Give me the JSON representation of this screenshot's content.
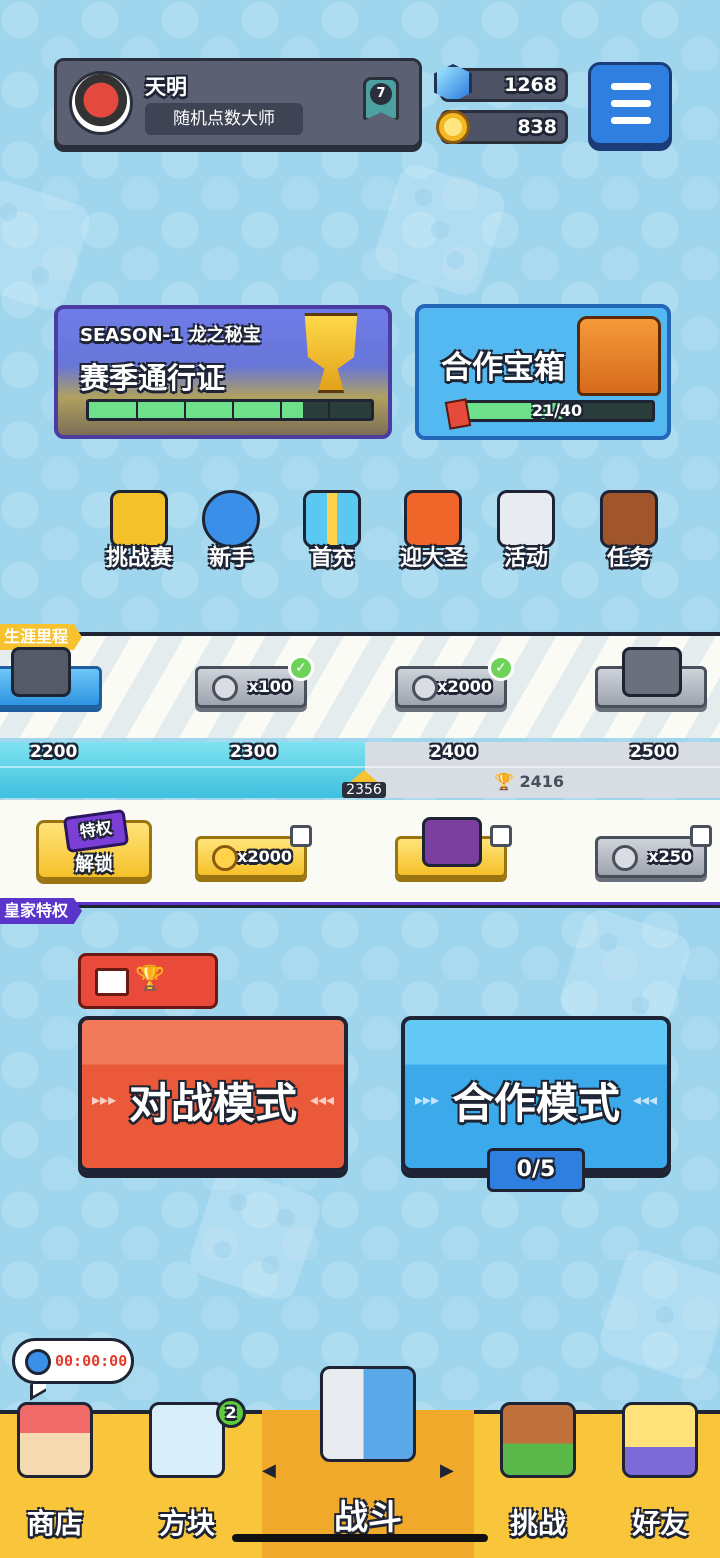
{
  "profile": {
    "name": "天明",
    "title": "随机点数大师",
    "rank": "7"
  },
  "currency": {
    "gems": "1268",
    "coins": "838"
  },
  "season_pass": {
    "subtitle": "SEASON-1 龙之秘宝",
    "title": "赛季通行证",
    "progress": 0.76
  },
  "coop_chest": {
    "title": "合作宝箱",
    "progress_label": "21/40",
    "progress": 0.525
  },
  "features": [
    {
      "label": "挑战赛",
      "icon": "challenge-box-icon",
      "color": "#f5c12a"
    },
    {
      "label": "新手",
      "icon": "stopwatch-icon",
      "color": "#3a8fe8"
    },
    {
      "label": "首充",
      "icon": "gift-box-icon",
      "color": "#ffd24a"
    },
    {
      "label": "迎大圣",
      "icon": "lantern-icon",
      "color": "#f0662a"
    },
    {
      "label": "活动",
      "icon": "document-icon",
      "color": "#e8ecf0"
    },
    {
      "label": "任务",
      "icon": "quest-book-icon",
      "color": "#a0552a"
    }
  ],
  "career": {
    "tag": "生涯里程",
    "top_rewards": [
      {
        "label": "",
        "icon": "skull-chest-icon",
        "claimed": false
      },
      {
        "label": "x100",
        "icon": "dice-icon",
        "claimed": true
      },
      {
        "label": "x2000",
        "icon": "silver-coin-icon",
        "claimed": true
      },
      {
        "label": "",
        "icon": "silver-chest-icon",
        "claimed": false
      }
    ],
    "milestones": [
      "2200",
      "2300",
      "2400",
      "2500"
    ],
    "current": "2356",
    "next_trophy": "2416",
    "bottom_rewards": [
      {
        "label": "x2000",
        "icon": "gold-coin-icon",
        "locked": true
      },
      {
        "label": "",
        "icon": "purple-chest-icon",
        "locked": true
      },
      {
        "label": "x250",
        "icon": "dice-icon",
        "locked": true
      }
    ],
    "unlock_badge": "特权",
    "unlock_label": "解锁",
    "royal_tag": "皇家特权"
  },
  "modes": {
    "battle": "对战模式",
    "coop": "合作模式",
    "coop_count": "0/5"
  },
  "timer": "00:00:00",
  "nav": {
    "shop": "商店",
    "blocks": "方块",
    "blocks_badge": "2",
    "battle": "战斗",
    "challenge": "挑战",
    "friends": "好友"
  },
  "colors": {
    "background": "#9fd6ee",
    "nav_bar": "#f9c53a",
    "battle_red": "#ea5a3a",
    "coop_blue": "#3ba9ea",
    "progress_green": "#6ee08c"
  }
}
